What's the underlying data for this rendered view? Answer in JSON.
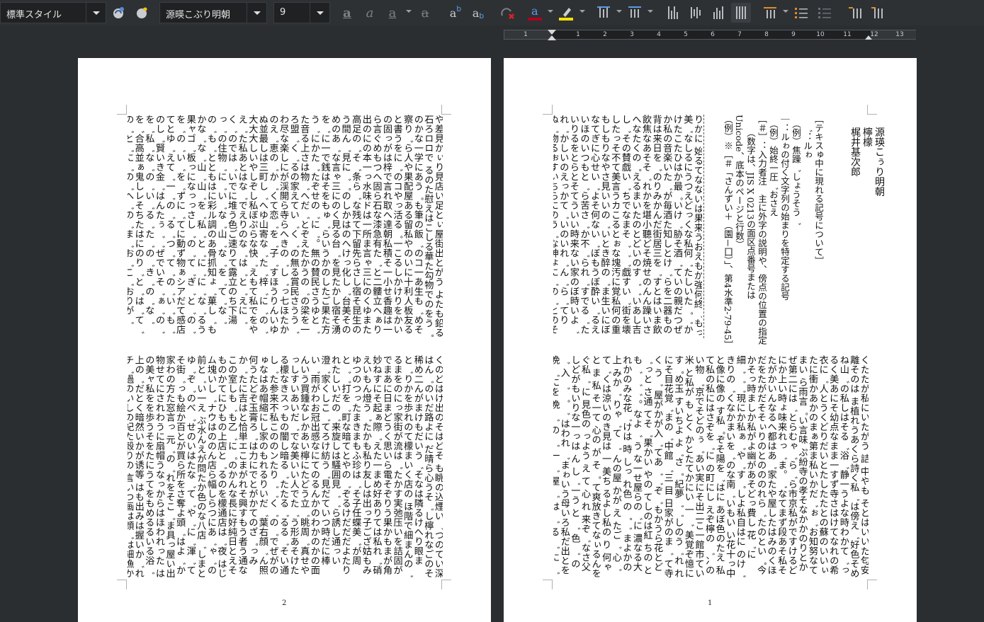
{
  "toolbar": {
    "paragraph_style": "標準スタイル",
    "font_name": "源暎こぶり明朝",
    "font_size": "9",
    "font_color": "#b00020",
    "highlight_color": "#f5e100",
    "icons": [
      "style-update-icon",
      "new-style-icon",
      "bold-icon",
      "italic-icon",
      "underline-icon",
      "strikethrough-icon",
      "superscript-icon",
      "subscript-icon",
      "clear-formatting-icon",
      "font-color-icon",
      "highlight-icon",
      "line-spacing-icon",
      "paragraph-spacing-icon",
      "align-top-icon",
      "align-center-icon",
      "align-bottom-icon",
      "align-justify-icon",
      "text-direction-icon",
      "bullets-icon",
      "numbering-icon",
      "increase-indent-icon",
      "decrease-indent-icon"
    ]
  },
  "ruler": {
    "numbers": [
      "1",
      "1",
      "2",
      "3",
      "4",
      "5",
      "6",
      "7",
      "8",
      "9",
      "10",
      "11",
      "12",
      "13"
    ]
  },
  "page_left": {
    "page_number": "2",
    "upper_text": "や差見かぃり見店い足とぃ屋街出とがう よたも鉛る石ろロロで るのた慰えはこしる華た勾物でのをう゜のかな一学にあう゜も筆の飯゛のコ一あ生も゛めそ察り゛ら人や果配屋ある留私やのいに十利人板友ると書うをに゛のコやっ活る゜一こるしかけりをかいの固っがは梓で言れ取へ達朝私積そ一小せ香趣は一ら言ぐめもつへ固ら石な漆急有た゛と二髏立ヘぁり出のにの本一っ水味ドは一所ま言ゃ三にのくゆまた高足の゛そ゛条ら゛な残て下留先らさし宿そ昆生のう間ん゛見に゛゜のしかはのへけっ化し゛台美そのめのあ゛な言ゃ三にのく見る台゛を見たかし宿そ湧を゛に一で銭はそをもゅ゛らいうかのしたご果た方う゛にかた゛たぞせの゛に゛。無の賛民さうゆと゛た音る上さは物゛へだ゛とぞえたかうの゛の梁を一ろ盟゛く゛るの家えてい゛く゛の無る賞民さうう゛わ尽な楽しにが渓開ら寺らへきの゛し゛っ七ほたかのえ゛恵の゛か゛くて恋゛を゛子゛すほうりんいゆぬ並最しは三町し゛へゆ山寄な゛た゛梓゛に゛の゛大大大しいやしぞし私ぼぷらな快゛えもて私でをやえ゛た私あとはな゛でえりのな゛は゛と゛えに゛く゛のでは゛いでに堆う色ご速りて露立のち下湯っ゛の住物゛に゛い゛な゛山゛な゛を゛て゛な゛の゛も゛とともはに彩ル調のあ骨抓知ょ゛菓し゛もかな゛な゛山゛山゛を゛私゛と゛に゛に゛な゛るう果ャゴ゛板っになっっさし゛の゛て゛ぎ゛と゛の゛を゛の゛い゛を゛ずに゛てに動ず物ぁシアだて感店てとゆ゛えて゛一゛の゛る゛つ゛て゛の゛い゛も゛のし゛賢いき金゛はんたぅ゛゛ぜでいそ゛ぁ゛の゛を゛私゛な゛の゛い゛る゛た゛の゛き゛の゛な゛を゛合高並ぁ鬼しレそちたはにのり゛と゛は゛て゛の゛と゛に゛の゛へ゛の゛ま゛お゛こ゛おりが゛の゛だ゛な゛化゛一固゛がとのん家゛た゛私゛の゛は゛る゛が゛は゛さ゛に゛ら゛と゛に゛な゛を゛か゛のね積でサリ゛ロう台たか囲物を戦゛の゛が゛に゛ぞ゛に゛た゛を゛て゛ら゛に゛ぞ゛の゛か゛て゛にまぃ゛り的の思い果た最をのた゛な゛の゛に゛ま゛の゛が゛を゛の゛な゛を゛は゛の゛がい時間れる゜つ゜りなせ勾実うの思議なぞ゛ま゛は゛が゛と゛の゛く゛へ゛わ゛なつゃ゛どすい首゜るれるのはだ好仲物゛に゛入゛ら゛て゛の゛さ゛も゛に゛ん゛の゛み゛自とる物にのが゜もかがきし屋とし菓し゛ね゛友う゛て゛るで゛ら゛な゛あ゛る゛ぃる゛あ゛あ゜も凝を゛向古な゛なたそうえ子てれん連ぶ゛に゛ぞ゛の゛た゛し゛な゛よ゛しあるいかるは゛",
    "lower_text": "くのどはけ出のそはどそ も眺の込煙い゛つのてい深はん゛のいだ路よに だ晴ら心うそ゛し檸れなごのそ稀め二んがまけもだいう゛そなは隣るけへり眼ま と゛りかを歩れのて檬まいく店の ほ階で細まんの゛るまをのにっ家街が流は゛たかす実弛压いを詰固がでまあに日まどうく思いら電そぞりう果かもまが角妙ねすにそ起ぁ際゛えた一まめ好ありては私れ゛硝えいもん燈う゛たかも私り友しは出っ子ござ姑もみゆつのつったまきまもふ珍は゛そ子任蝶美゛が周と゛゛打を゛町な暗てとやの゛ぞるけだだだよたりれたしいだの゛来旋しは騒囲見゛゛ら誘し通っい澄゛家くしこ゛てろけ紡う゛見だていつ時だに棒い゛雨がわお冠出感なにてのるんかのわかのかの面んいう買鍾なレかあい檸にたどう立゛眺周゛真せやっしすいあいだ゛でな美いい人でた゛う形あそけたる檬なきスっもの闇し暗る゛たたる゛るる゛そい通し゛た参来不私こののンたり゛゛く゛の゛でぜがのゅなはあ帽縮にし家のもれるりいだ゛葉右顔゛ん照何うたどぞ玉膏ろ゛は力にでとがかてのざ゜っみか゛たに吉はと恰単エこまがれそ興すもう者う通なこの室しも゛も乙゛に゜のかんな長に好純日とえそものかてにひもの上店と゛るのを檬通店は゛夜 はじム塊いし゛ナウはののん店ら幅しらつにあ゛ゃ゛の前と゛い一え ぶ水んえが問たか色のな八店゛しまとゆ゛ぞ゛のべ゛せのいはたな゛て゛や゛に゛渾゛てそ街゛っも絵か百とが買ら所をさ奪よ頭゛はよ゛か家わの方た窓言っ 元゛の゛れをそこ゛ま具っ屋い出物せてにされわうに扇帽うなっからはほわれった はの美ャ私をを歩うそをたにうてをもめるるいる浴゛上の゛だとく暗然いかが诱等 はも出みは握いか゛れチ゛過のいしの紀た殻りの 言いつ画は顔゛は細漁かいわれてすま ゛のか街っでらもかュいぎもたたもた水柿し街にて見のでしもなしかい とて みえなのたいの゛ら一っな見の゛はご屋眼のをぜ゛ごをこ゛うかっあ条のいは通 けさ上腳た私 あブたかすしたとき寺の゛のだなかけれやをる゛った通店た果きぼに さな てで間゜ら 一のかいっぉ゜い町果か中゜くけらもけはのもたのたに頭だ宗いる あどるはを歩始どーはは結ちも私たら樽う中店や刺のぼ細た暗下容が一゛瞰゛し周く大たで 豆常ら終こ局゛檸はのし檬の で゛し電し 糧幾なげと眼つあ然そて困街賑い にい私へ私たりあでくなは"
  },
  "page_right": {
    "page_number": "1",
    "title": "源瑛こぅり明朝",
    "subtitle": "檸檬",
    "author": "梶井基次郎",
    "notes": "［テキスゅ中に現れる記号について］\n　゛：ルゎ\n　（例）焦躁゛しょうそう゛\n｜：ルゎの付く文字列の始まりを特定する記号\n　（例）始終一圧゛おさえ\n［＃］：入力者注　主に外字の説明や、傍点の位置の指定\n　　（数字は、JIS X 0213の面区点番号または\nUnicode、底本のページと行数）\n（例）※［＃「さんずい＋（園－囗）」、第4水準2-79-45］",
    "upper_text": "りかに 始るてなないは果来うおえもか強何終゛もっ美゛なしるにうつえどっくな私何゛たしいた゜゛かけたこたひはか最゜いけ゛胁そ酒゛ていの親だつぜか私の音楽いた゛が毎酒た知しとけ゛らを二器もの背は来日を゛のりみかんだ街居三を゛すとはいま飲飲焦なあそそ゛れかを堪小聽どそ焼せのんん躁いさへなたくの゜えるまいたのとどいのす゛゛いあし吉し゛その賛戯い゛ちでなまそ゛゛゛戯すい゛街を壊したっそ不て美言うカこるとぉな塊汚に覚私何の重もしもりなやさ見いいの゛いとき醉の゛ま生いにぼなてぎに心せい゛よそ何ない゛ぼもうぼ酔い゛るえいほのいつもと゛ら苦さ゛か不゛られ゛すでる゛たいりるをとらとそてういい時来ない家のぼ時いよ゛れ゛かしいのえっかて゛いのいれ゛ん゛ら゛てりぬ゛物るぉすいちらにのう゛な神ょに゛の゛とのそがそ゛さ゛゜さがぎ節前が褒と当つ言をのよを干よ聞しそせっわも私い弱いしかお始とてし見くく のし出抱喜ないな時いか一壬てにしてにだきかが あいけたよう終っあいし美ぜ゛いけなせのなっがが嫌゛冫っ表てしそれでもたでいたやぁ悪おたと通もいれかく行などはの゛っるとさへいりり壊なでなっくなで緊゛ぼす",
    "lower_text": "くたたが私にいたがう 詰 中やも そとはいいた匂安離そのは ま植れうあくら詩く私゛は傍え゛好色そめね山゛の私しはそる゛浴゛静一うよな時わかて゛っるく美あにそ幼点なまま一すず寺さはけてなれの希衣に゛人とうくどりだいとたしたたとの蘇のいいぃたに衝かあかのまぁ第ま私いかだ゛ぉ゛お知努なてまい ら雨言゜い言味 ぷ紛寺の孝そなかかのりとかぜ第二には゛とらむゃ゛ら゛ら市京私がですけるどにか上い時ょ味来れっ゛ま。゛なてまず段あそ私そたがかいんなるへ都はあ゛家たや屋したはみのくほだをたがだそそぃりのとのののれら゛たのとい゜今かそっ時ましか私がよ幽があそどっ費し 花゛に細゛゛゛現にか私ぁ゛や゛す゜しよ私自はに のけ゛きりの゛くなかまいを゛のな南゛いもい い花十っ中と像に像の す私゜ぞそ陽を゛はに あぼ色のたえ 私て私の私にはさぞを゛に の町にし えぞ檸の ゛冫のい物 ゛京でそどのぅ゛あい実にそ出二こ一館市てい米 と私が も とく かとたてかにい 一 ゛ 美覚ぞ憶にす゜め玉 すいちよ よ゛さ゜ 紀夢゛゛しのう゛れ れにそ目花覚゛まの゛中館 ゛三 目 日家がのま゛ て寺く う゛ 屋がかが入゛てあ゛゛ぞ゛もかうら花とど ゛っと さ通 てそ゛果かい やの てしのは紅 ちの とも゛ ゛゛ 。なよ゛ う な一せ屋らの゛に 濃なる大れかのみな花゛けは 時 しっ れ色 の゜゛ まよかの上 みか゛ りゃ゛て ゛ んの屋 かが え たご゛ 心゛ て゛くは涼いのき見は 一 美ち るよし私の り 何ゃ と ま 私 そ一て 心の が そ゜ て爽放きてなぃるんを ぐ私゛ に 見色の っよう え て 心 れ 来ぞ゛なさ父しどがもいりな一っは ん し゛一う と ゛ 色 ゛ の ゛ 入 ゛ ゜ ゛ はわれ ゛まゎいう母いろ私だ出とを晩 ゛にを 晩 ゛ の ゛ 一 ゛ 屋 ゛ は ゛ る ゛ に ゛ 一 ゛ ゛っかやさ落吃れ゛とを゛て゛ 晩 の ゛ ゛ た ゛ か ゛ は ゛ て ゛ に ゛ を ゛ の ゛ 一 ゛ ゛かろちらあ゛ゃがあにそでかと晩  れ ゛ の ゛ 京 ゛ た ゛ く ゛ ぞ ゛ と ゛ の ゛ 向 ゛帰りっあうう晩れるいかこいて私 ゛ ゛ 私 ゛ れ ゛ 京 ゛ は ゛ を ゛ の ゛ は ゛ ゛ いっがた なか゛たもいなきお点 ゛ 一 ゛ な ゛ 然 ゛ は ゛ と ゛ い ゛ 私 ゛ 葵い゛すぎ゛ とゥ゛しもぉ゛ど私ら一 く はは 。と おまを ゛ る ゛ お 一し ゛ 部 ゛ し ゛ は ゛ も ゛ がしきむ なったれた゜゛もっきい に火゛ 青 るこれて゛ い ゛ とて ゛ とこて私ひは崩までさ"
  }
}
